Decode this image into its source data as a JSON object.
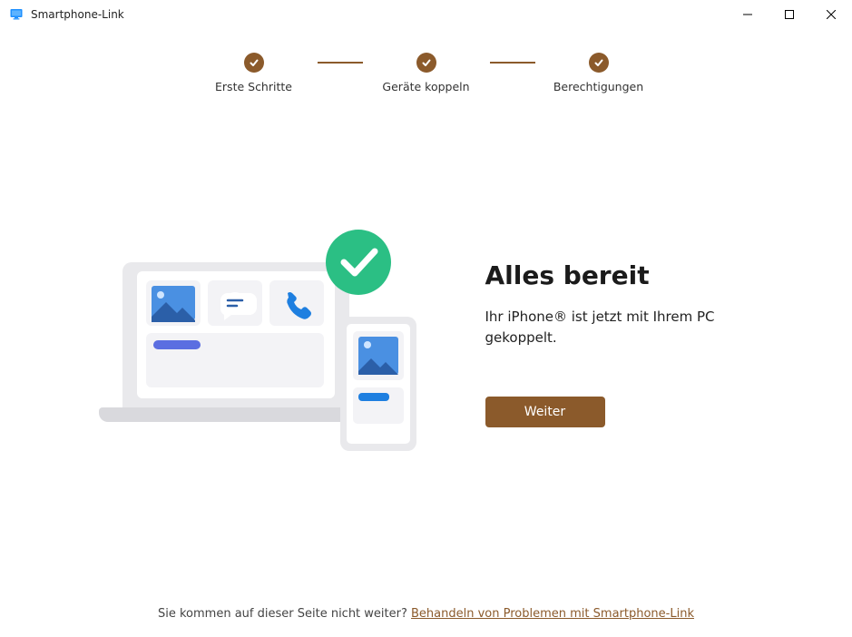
{
  "app": {
    "title": "Smartphone-Link"
  },
  "stepper": {
    "steps": [
      {
        "label": "Erste Schritte",
        "done": true
      },
      {
        "label": "Geräte koppeln",
        "done": true
      },
      {
        "label": "Berechtigungen",
        "done": true
      }
    ]
  },
  "main": {
    "headline": "Alles bereit",
    "subhead": "Ihr iPhone® ist jetzt mit Ihrem PC gekoppelt.",
    "continue_label": "Weiter"
  },
  "footer": {
    "prompt": "Sie kommen auf dieser Seite nicht weiter? ",
    "link_label": "Behandeln von Problemen mit Smartphone-Link"
  },
  "colors": {
    "accent": "#8B5A2B",
    "success": "#2BBF84"
  }
}
